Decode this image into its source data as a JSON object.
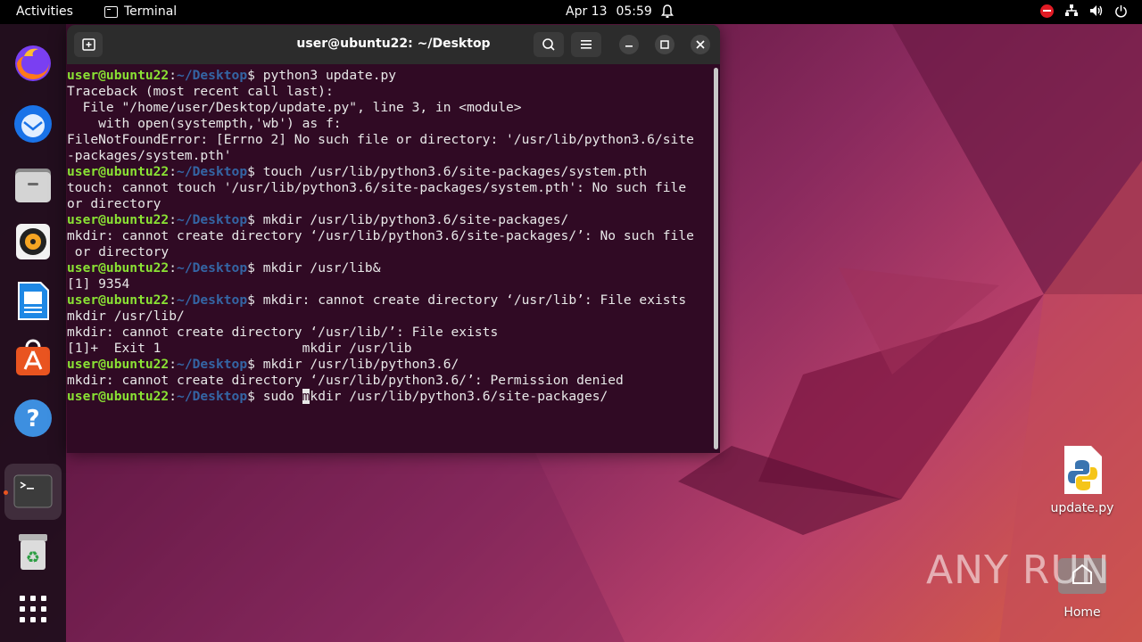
{
  "topbar": {
    "activities": "Activities",
    "app_name": "Terminal",
    "date": "Apr 13",
    "time": "05:59"
  },
  "dock": {
    "items": [
      "firefox",
      "thunderbird",
      "files",
      "rhythmbox",
      "libreoffice-writer",
      "software",
      "help",
      "terminal",
      "trash",
      "show-apps"
    ]
  },
  "terminal": {
    "title": "user@ubuntu22: ~/Desktop",
    "prompt_user": "user@ubuntu22",
    "prompt_sep": ":",
    "prompt_path": "~/Desktop",
    "prompt_end": "$ ",
    "lines": [
      {
        "cmd": "python3 update.py"
      },
      {
        "text": "Traceback (most recent call last):"
      },
      {
        "text": "  File \"/home/user/Desktop/update.py\", line 3, in <module>"
      },
      {
        "text": "    with open(systempth,'wb') as f:"
      },
      {
        "text": "FileNotFoundError: [Errno 2] No such file or directory: '/usr/lib/python3.6/site"
      },
      {
        "text": "-packages/system.pth'"
      },
      {
        "cmd": "touch /usr/lib/python3.6/site-packages/system.pth"
      },
      {
        "text": "touch: cannot touch '/usr/lib/python3.6/site-packages/system.pth': No such file"
      },
      {
        "text": "or directory"
      },
      {
        "cmd": "mkdir /usr/lib/python3.6/site-packages/"
      },
      {
        "text": "mkdir: cannot create directory ‘/usr/lib/python3.6/site-packages/’: No such file"
      },
      {
        "text": " or directory"
      },
      {
        "cmd": "mkdir /usr/lib&"
      },
      {
        "text": "[1] 9354"
      },
      {
        "cmd": "mkdir: cannot create directory ‘/usr/lib’: File exists"
      },
      {
        "text": "mkdir /usr/lib/"
      },
      {
        "text": "mkdir: cannot create directory ‘/usr/lib/’: File exists"
      },
      {
        "text": "[1]+  Exit 1                  mkdir /usr/lib"
      },
      {
        "cmd": "mkdir /usr/lib/python3.6/"
      },
      {
        "text": "mkdir: cannot create directory ‘/usr/lib/python3.6/’: Permission denied"
      }
    ],
    "last_cmd_before": "sudo ",
    "last_cmd_cursor": "m",
    "last_cmd_after": "kdir /usr/lib/python3.6/site-packages/"
  },
  "desktop": {
    "file_label": "update.py",
    "home_label": "Home",
    "watermark": "ANY RUN"
  },
  "colors": {
    "terminal_bg": "#300a24",
    "prompt_user": "#8ae234",
    "prompt_path": "#3465a4",
    "accent": "#e95420"
  }
}
